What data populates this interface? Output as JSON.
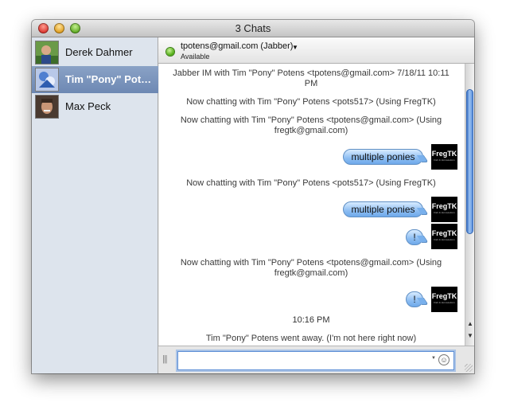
{
  "window": {
    "title": "3 Chats"
  },
  "contacts": [
    {
      "name": "Derek Dahmer"
    },
    {
      "name": "Tim \"Pony\" Potens"
    },
    {
      "name": "Max Peck"
    }
  ],
  "header": {
    "account": "tpotens@gmail.com (Jabber)",
    "status": "Available"
  },
  "messages": [
    {
      "text": "Jabber IM with Tim \"Pony\" Potens <tpotens@gmail.com>  7/18/11 10:11 PM"
    },
    {
      "text": "Now chatting with Tim \"Pony\" Potens <pots517> (Using FregTK)"
    },
    {
      "text": "Now chatting with Tim \"Pony\" Potens <tpotens@gmail.com> (Using fregtk@gmail.com)"
    },
    {
      "text": "multiple ponies"
    },
    {
      "text": "Now chatting with Tim \"Pony\" Potens <pots517> (Using FregTK)"
    },
    {
      "text": "multiple ponies"
    },
    {
      "text": "!"
    },
    {
      "text": "Now chatting with Tim \"Pony\" Potens <tpotens@gmail.com> (Using fregtk@gmail.com)"
    },
    {
      "text": "!"
    },
    {
      "text": "10:16 PM"
    },
    {
      "text": "Tim \"Pony\" Potens went away. (I'm not here right now)"
    }
  ],
  "avatar_label": "FregTK",
  "avatar_sublabel": "Fish & Vermuteform",
  "input": {
    "value": "",
    "placeholder": ""
  },
  "icons": {
    "close": "close-button",
    "minimize": "minimize-button",
    "zoom": "zoom-button",
    "status": "available-status-icon",
    "dropdown": "chevron-down-icon",
    "smiley": "smiley-icon"
  },
  "colors": {
    "sidebar_bg": "#dde4ed",
    "selection": "#7a93bd",
    "bubble": "#8cbdf2",
    "status_green": "#4aa80c"
  }
}
